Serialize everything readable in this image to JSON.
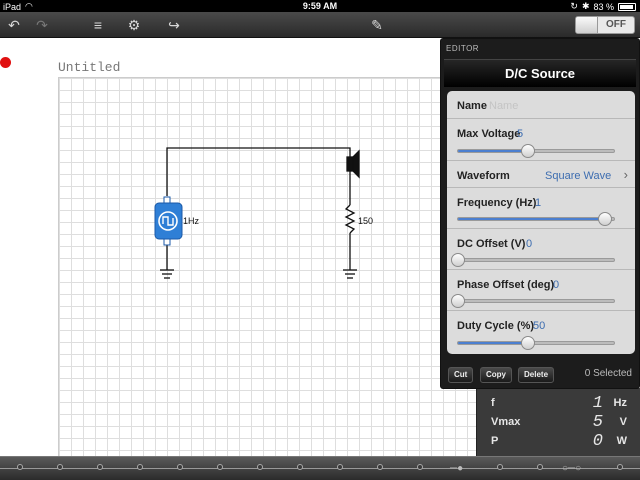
{
  "status_bar": {
    "device": "iPad",
    "time": "9:59 AM",
    "battery": "83 %"
  },
  "toolbar": {
    "toggle_label": "OFF"
  },
  "document": {
    "title": "Untitled"
  },
  "circuit": {
    "source_label": "1Hz",
    "resistor_label": "150"
  },
  "editor": {
    "header": "EDITOR",
    "title": "D/C Source",
    "properties": {
      "name": {
        "label": "Name",
        "placeholder": "Name"
      },
      "max_voltage": {
        "label": "Max Voltage",
        "value": "5",
        "slider_fraction": 0.45
      },
      "waveform": {
        "label": "Waveform",
        "value": "Square Wave"
      },
      "frequency": {
        "label": "Frequency (Hz)",
        "value": "1",
        "slider_fraction": 0.94
      },
      "dc_offset": {
        "label": "DC Offset (V)",
        "value": "0",
        "slider_fraction": 0.0
      },
      "phase_offset": {
        "label": "Phase Offset (deg)",
        "value": "0",
        "slider_fraction": 0.0
      },
      "duty_cycle": {
        "label": "Duty Cycle (%)",
        "value": "50",
        "slider_fraction": 0.45
      }
    },
    "footer": {
      "cut": "Cut",
      "copy": "Copy",
      "delete": "Delete",
      "selected": "0 Selected"
    }
  },
  "meter": {
    "rows": [
      {
        "label": "f",
        "value": "1",
        "unit": "Hz"
      },
      {
        "label": "Vmax",
        "value": "5",
        "unit": "V"
      },
      {
        "label": "P",
        "value": "0",
        "unit": "W"
      }
    ]
  },
  "colors": {
    "accent": "#4b7fd0",
    "source_fill": "#2f7fd6",
    "record": "#e01010"
  }
}
